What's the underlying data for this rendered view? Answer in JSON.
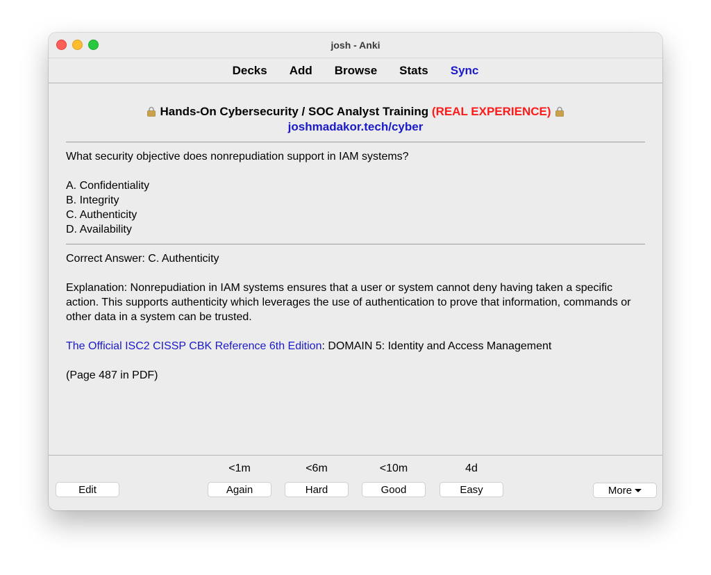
{
  "window": {
    "title": "josh - Anki"
  },
  "toolbar": {
    "decks": "Decks",
    "add": "Add",
    "browse": "Browse",
    "stats": "Stats",
    "sync": "Sync"
  },
  "card": {
    "header": {
      "lock_icon": "lock-icon",
      "title_black": "Hands-On Cybersecurity / SOC Analyst Training",
      "title_red": "(REAL EXPERIENCE)",
      "site": "joshmadakor.tech/cyber"
    },
    "question": "What security objective does nonrepudiation support in IAM systems?",
    "options": [
      "A. Confidentiality",
      "B. Integrity",
      "C. Authenticity",
      "D. Availability"
    ],
    "answer": "Correct Answer: C. Authenticity",
    "explanation": "Explanation: Nonrepudiation in IAM systems ensures that a user or system cannot deny having taken a specific action. This supports authenticity which leverages the use of authentication to prove that information, commands or other data in a system can be trusted.",
    "reference_link": "The Official ISC2 CISSP CBK Reference 6th Edition",
    "reference_rest": ": DOMAIN 5: Identity and Access Management",
    "page": "(Page 487 in PDF)"
  },
  "bottom": {
    "edit": "Edit",
    "answers": [
      {
        "interval": "<1m",
        "label": "Again"
      },
      {
        "interval": "<6m",
        "label": "Hard"
      },
      {
        "interval": "<10m",
        "label": "Good"
      },
      {
        "interval": "4d",
        "label": "Easy"
      }
    ],
    "more": "More"
  }
}
